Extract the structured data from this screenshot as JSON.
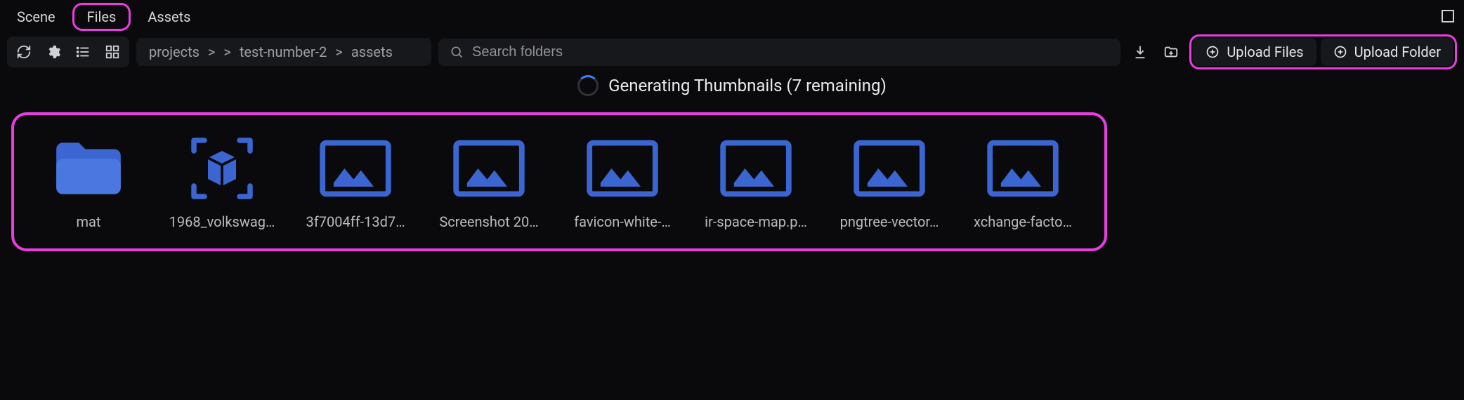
{
  "tabs": {
    "scene": "Scene",
    "files": "Files",
    "assets": "Assets",
    "active": "files"
  },
  "breadcrumb": {
    "root": "projects",
    "mid": "test-number-2",
    "leaf": "assets",
    "sep": ">"
  },
  "search": {
    "placeholder": "Search folders"
  },
  "actions": {
    "upload_files": "Upload Files",
    "upload_folder": "Upload Folder"
  },
  "status": {
    "text": "Generating Thumbnails (7 remaining)"
  },
  "items": [
    {
      "kind": "folder",
      "label": "mat"
    },
    {
      "kind": "model",
      "label": "1968_volkswag…"
    },
    {
      "kind": "image",
      "label": "3f7004ff-13d7…"
    },
    {
      "kind": "image",
      "label": "Screenshot 20…"
    },
    {
      "kind": "image",
      "label": "favicon-white-…"
    },
    {
      "kind": "image",
      "label": "ir-space-map.p…"
    },
    {
      "kind": "image",
      "label": "pngtree-vector…"
    },
    {
      "kind": "image",
      "label": "xchange-facto…"
    }
  ],
  "colors": {
    "accent": "#3b66d1",
    "highlight": "#e83ee0"
  }
}
